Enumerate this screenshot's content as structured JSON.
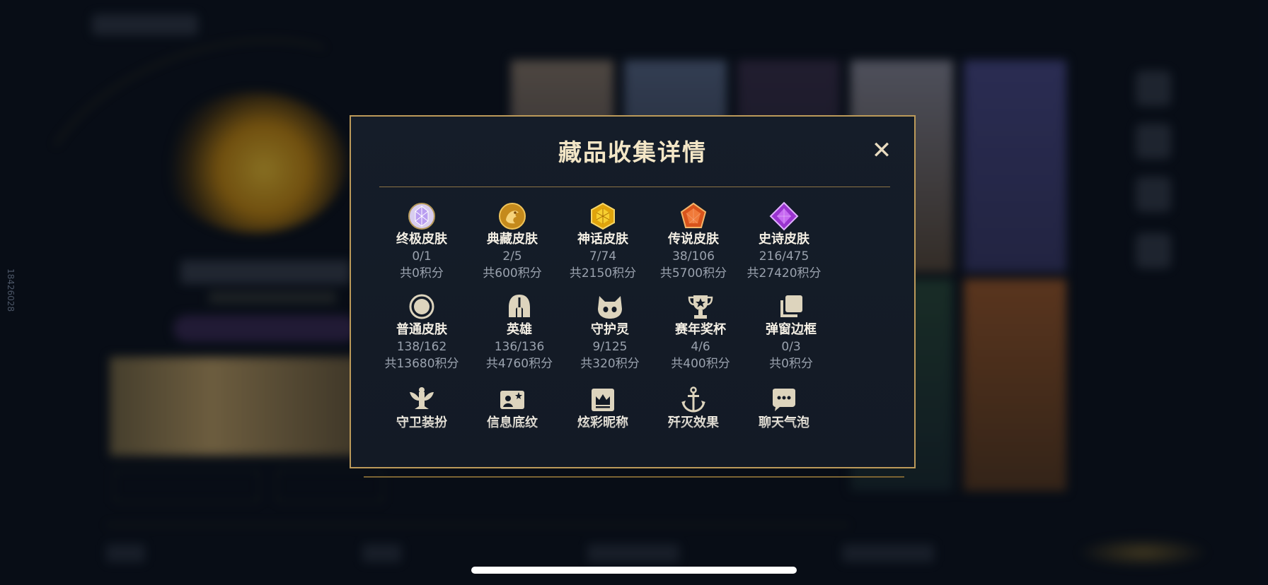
{
  "side_id": "18426028",
  "modal": {
    "title": "藏品收集详情",
    "close_label": "✕"
  },
  "categories": [
    {
      "name": "终极皮肤",
      "count": "0/1",
      "points": "共0积分",
      "icon": "ultimate-gem-icon",
      "color": "#c9b2f2"
    },
    {
      "name": "典藏皮肤",
      "count": "2/5",
      "points": "共600积分",
      "icon": "dragon-emblem-icon",
      "color": "#e2a631"
    },
    {
      "name": "神话皮肤",
      "count": "7/74",
      "points": "共2150积分",
      "icon": "mythic-gem-icon",
      "color": "#f0b416"
    },
    {
      "name": "传说皮肤",
      "count": "38/106",
      "points": "共5700积分",
      "icon": "legend-gem-icon",
      "color": "#e36424"
    },
    {
      "name": "史诗皮肤",
      "count": "216/475",
      "points": "共27420积分",
      "icon": "epic-gem-icon",
      "color": "#b34be2"
    },
    {
      "name": "普通皮肤",
      "count": "138/162",
      "points": "共13680积分",
      "icon": "circle-icon",
      "color": "#ddd4bd"
    },
    {
      "name": "英雄",
      "count": "136/136",
      "points": "共4760积分",
      "icon": "helmet-icon",
      "color": "#ddd4bd"
    },
    {
      "name": "守护灵",
      "count": "9/125",
      "points": "共320积分",
      "icon": "guardian-pet-icon",
      "color": "#ddd4bd"
    },
    {
      "name": "赛年奖杯",
      "count": "4/6",
      "points": "共400积分",
      "icon": "trophy-icon",
      "color": "#ddd4bd"
    },
    {
      "name": "弹窗边框",
      "count": "0/3",
      "points": "共0积分",
      "icon": "frame-icon",
      "color": "#ddd4bd"
    },
    {
      "name": "守卫装扮",
      "icon": "ward-icon",
      "color": "#ddd4bd"
    },
    {
      "name": "信息底纹",
      "icon": "card-pattern-icon",
      "color": "#ddd4bd"
    },
    {
      "name": "炫彩昵称",
      "icon": "crown-nameplate-icon",
      "color": "#ddd4bd"
    },
    {
      "name": "歼灭效果",
      "icon": "anchor-icon",
      "color": "#ddd4bd"
    },
    {
      "name": "聊天气泡",
      "icon": "chat-bubble-icon",
      "color": "#ddd4bd"
    }
  ]
}
